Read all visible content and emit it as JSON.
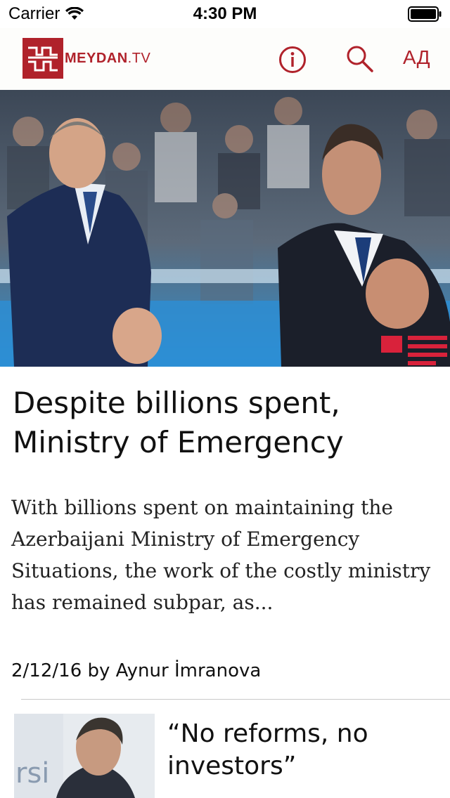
{
  "status_bar": {
    "carrier": "Carrier",
    "time": "4:30 PM"
  },
  "navbar": {
    "logo_text": "MEYDAN",
    "logo_suffix": ".TV",
    "language_label": "АД",
    "brand_color": "#b0222b"
  },
  "featured_article": {
    "headline": "Despite billions spent, Ministry of Emergency",
    "summary": "With billions spent on maintaining the Azerbaijani Ministry of Emergency Situations, the work of the costly ministry has remained subpar, as...",
    "byline": "2/12/16 by Aynur İmranova"
  },
  "next_article": {
    "headline": "“No reforms, no investors”"
  }
}
